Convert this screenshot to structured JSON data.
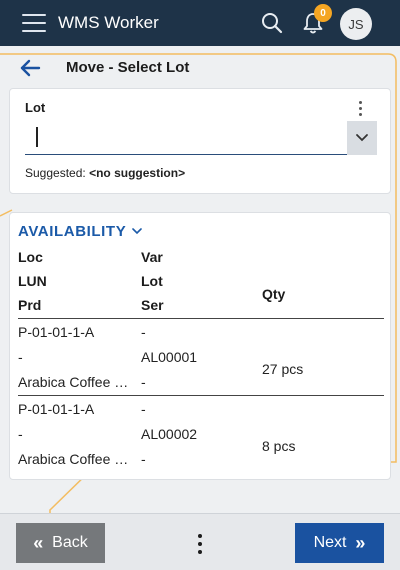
{
  "header": {
    "app_title": "WMS Worker",
    "notification_count": "0",
    "user_initials": "JS",
    "icons": [
      "menu-icon",
      "search-icon",
      "bell-icon"
    ]
  },
  "page": {
    "title": "Move - Select Lot"
  },
  "lot_field": {
    "label": "Lot",
    "value": "",
    "suggested_prefix": "Suggested: ",
    "suggested_value": "<no suggestion>"
  },
  "availability": {
    "title": "AVAILABILITY",
    "headers": {
      "loc": "Loc",
      "lun": "LUN",
      "prd": "Prd",
      "var": "Var",
      "lot": "Lot",
      "ser": "Ser",
      "qty": "Qty"
    },
    "rows": [
      {
        "loc": "P-01-01-1-A",
        "lun": "-",
        "prd": "Arabica Coffee Beans",
        "var": "-",
        "lot": "AL00001",
        "ser": "-",
        "qty": "27 pcs"
      },
      {
        "loc": "P-01-01-1-A",
        "lun": "-",
        "prd": "Arabica Coffee Beans",
        "var": "-",
        "lot": "AL00002",
        "ser": "-",
        "qty": "8 pcs"
      }
    ]
  },
  "footer": {
    "back_label": "Back",
    "next_label": "Next"
  },
  "colors": {
    "header_bg": "#1e3348",
    "accent_blue": "#1a52a0",
    "highlight_orange": "#f5a623"
  }
}
